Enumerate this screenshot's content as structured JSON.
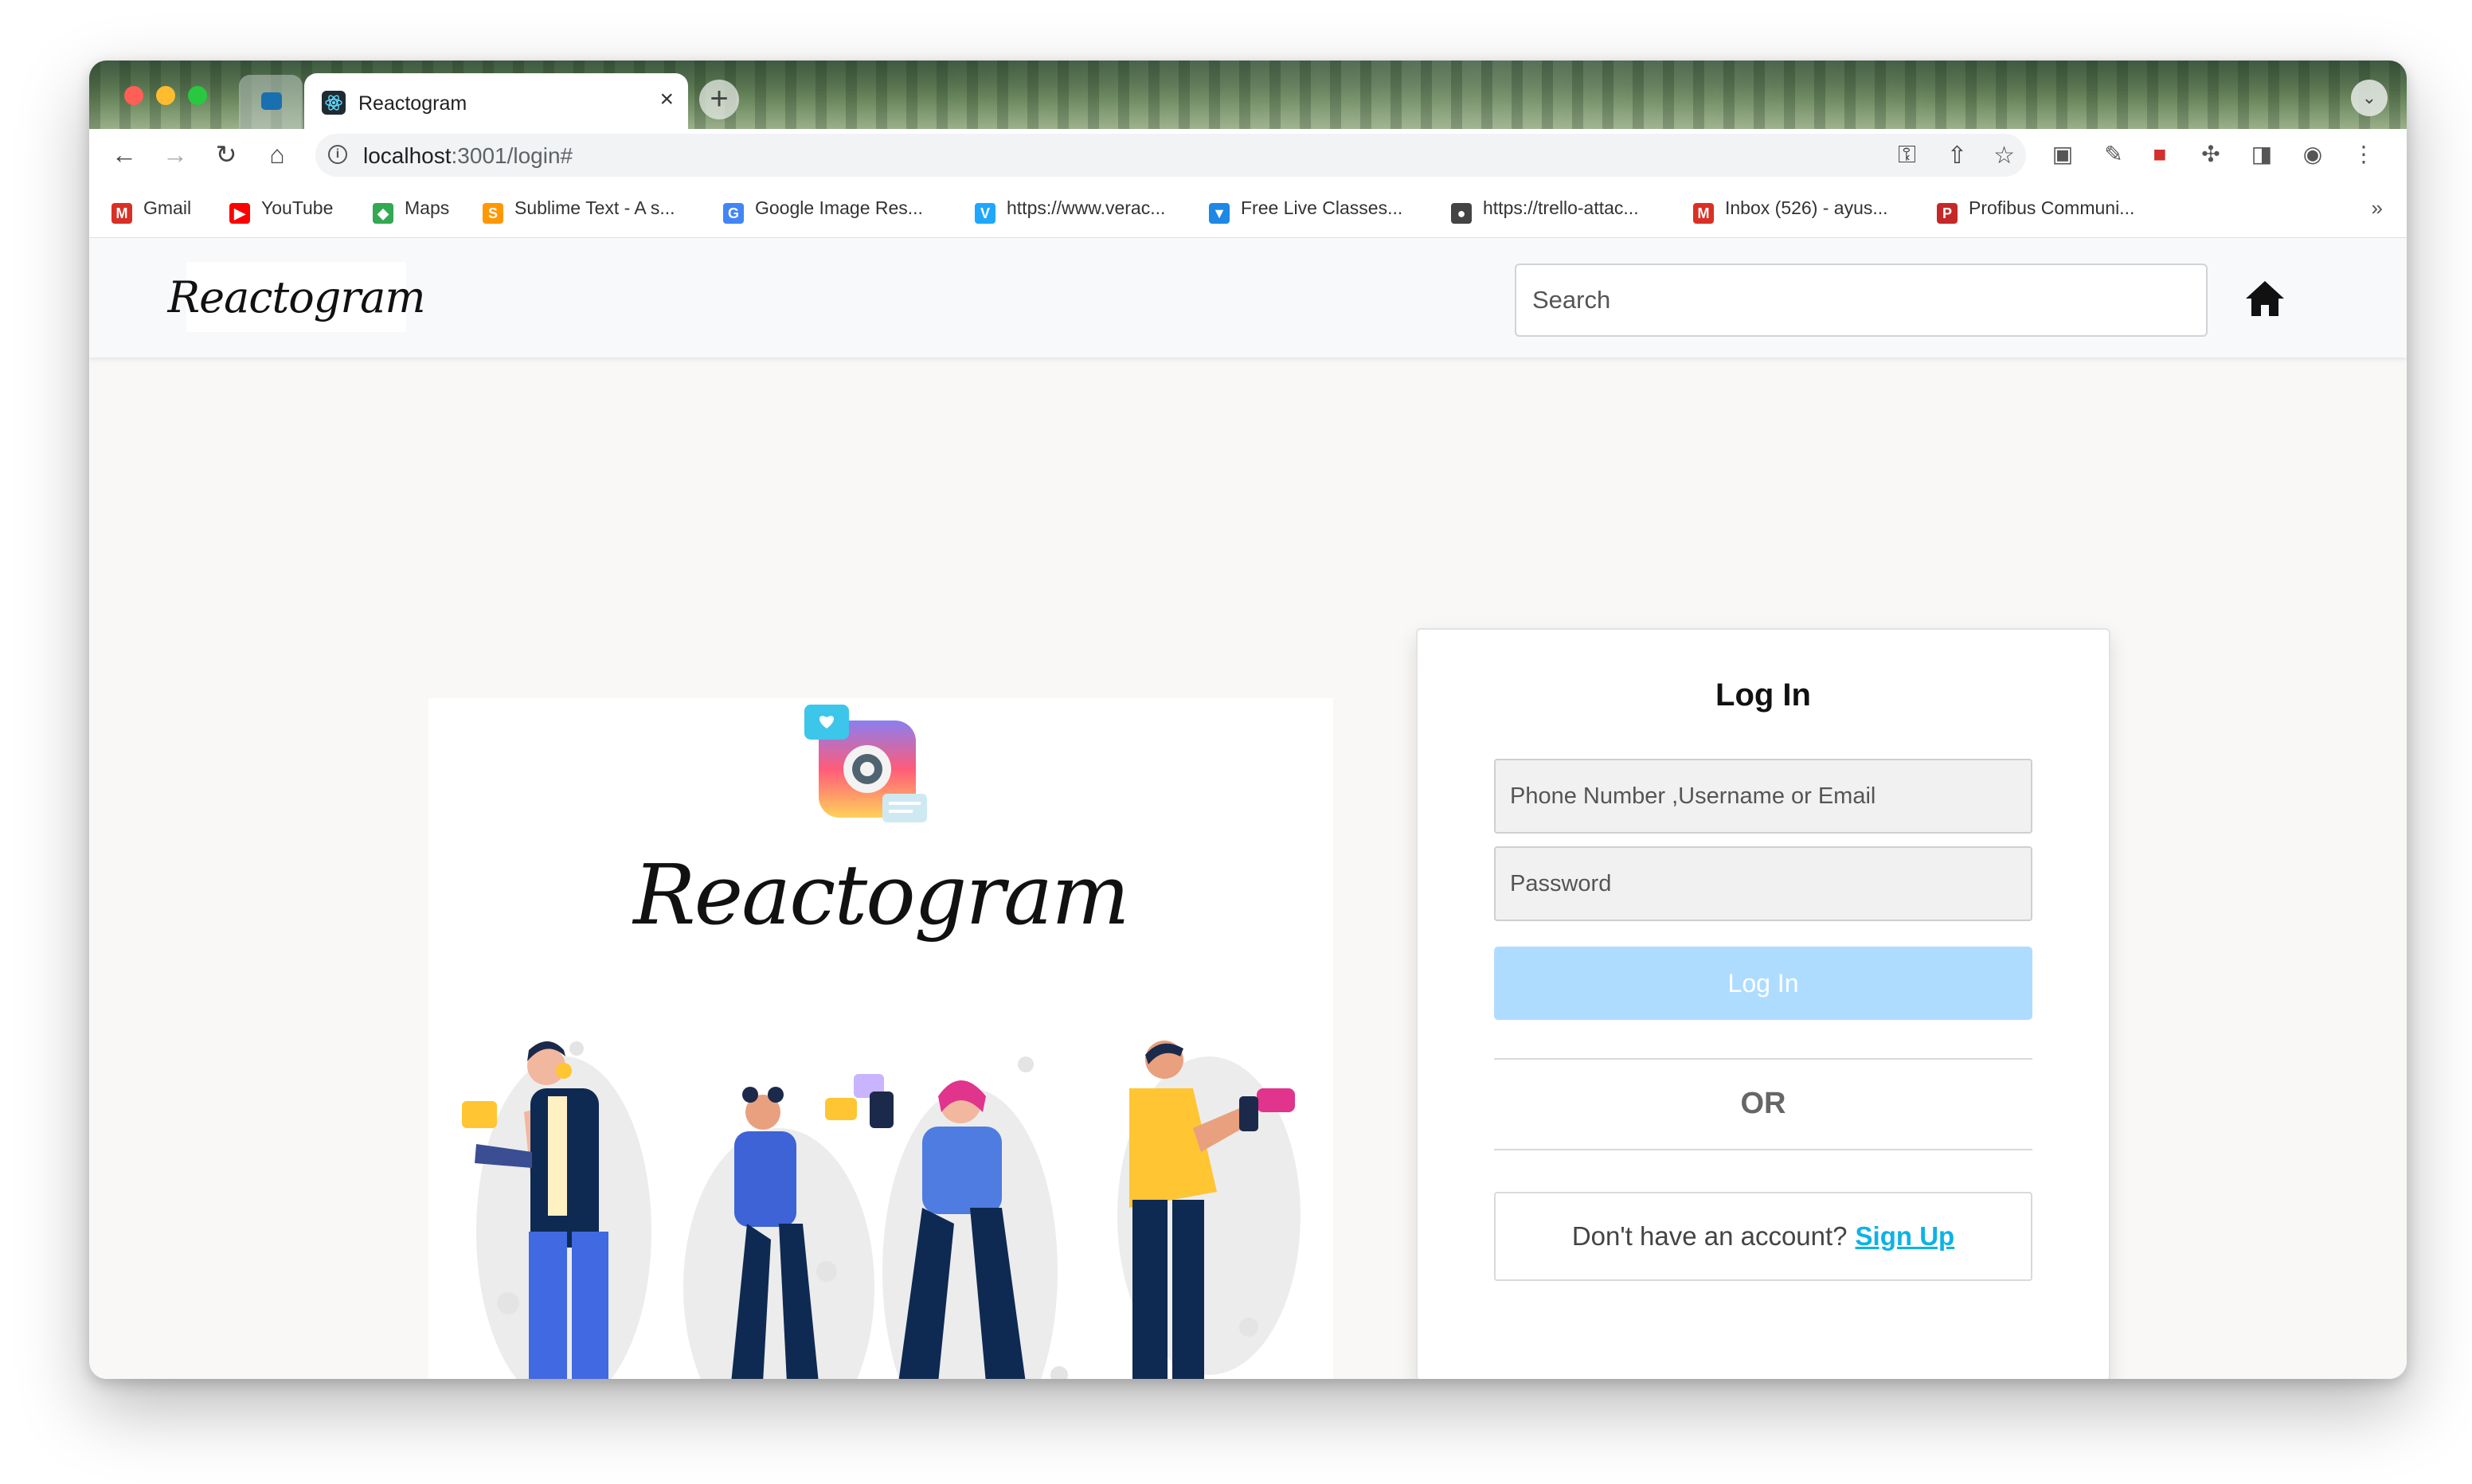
{
  "browser": {
    "active_tab": {
      "title": "Reactogram",
      "close_glyph": "×"
    },
    "new_tab_glyph": "+",
    "tab_menu_glyph": "⌄",
    "url_host": "localhost",
    "url_path": ":3001/login#",
    "bookmarks": [
      {
        "label": "Gmail",
        "icon": "gmail-icon",
        "color": "#d93025"
      },
      {
        "label": "YouTube",
        "icon": "youtube-icon",
        "color": "#ff0000"
      },
      {
        "label": "Maps",
        "icon": "maps-icon",
        "color": "#34a853"
      },
      {
        "label": "Sublime Text - A s...",
        "icon": "sublime-icon",
        "color": "#ff9800"
      },
      {
        "label": "Google Image Res...",
        "icon": "google-icon",
        "color": "#4285f4"
      },
      {
        "label": "https://www.verac...",
        "icon": "veracode-icon",
        "color": "#1ea7fd"
      },
      {
        "label": "Free Live Classes...",
        "icon": "live-classes-icon",
        "color": "#1e88e5"
      },
      {
        "label": "https://trello-attac...",
        "icon": "globe-icon",
        "color": "#444444"
      },
      {
        "label": "Inbox (526) - ayus...",
        "icon": "gmail-icon",
        "color": "#d93025"
      },
      {
        "label": "Profibus Communi...",
        "icon": "profibus-icon",
        "color": "#c62828"
      }
    ],
    "bookmarks_more": "»"
  },
  "navbar": {
    "brand": "Reactogram",
    "search_placeholder": "Search"
  },
  "hero": {
    "wordmark": "Reactogram"
  },
  "login": {
    "title": "Log In",
    "identifier_placeholder": "Phone Number ,Username or Email",
    "password_placeholder": "Password",
    "submit_label": "Log In",
    "or_text": "OR",
    "signup_prompt": "Don't have an account?",
    "signup_link": "Sign Up"
  },
  "colors": {
    "login_button": "#aedcff",
    "signup_link": "#0db2e6",
    "page_background": "#f9f8f7"
  }
}
